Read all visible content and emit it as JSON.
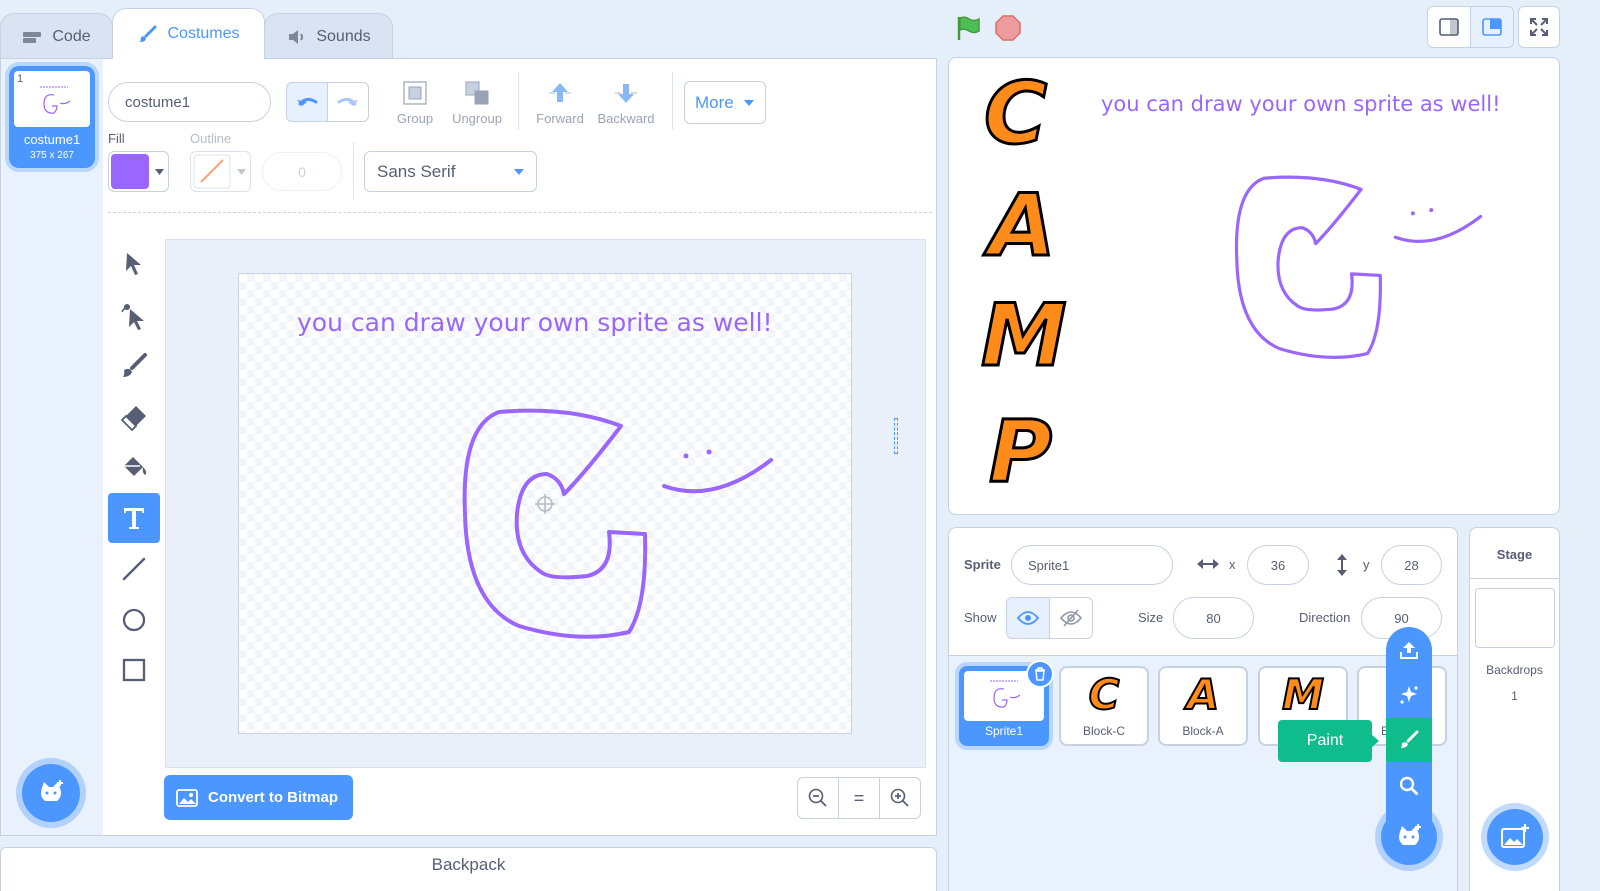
{
  "tabs": [
    {
      "label": "Code",
      "icon": "code-icon"
    },
    {
      "label": "Costumes",
      "icon": "brush-icon"
    },
    {
      "label": "Sounds",
      "icon": "speaker-icon"
    }
  ],
  "costume_list": {
    "items": [
      {
        "index": "1",
        "name": "costume1",
        "size": "375 x 267"
      }
    ]
  },
  "paint_editor": {
    "costume_name": "costume1",
    "group_label": "Group",
    "ungroup_label": "Ungroup",
    "forward_label": "Forward",
    "backward_label": "Backward",
    "more_label": "More",
    "fill_label": "Fill",
    "outline_label": "Outline",
    "outline_width": "0",
    "font": "Sans Serif",
    "fill_color": "#9966ff",
    "canvas_text": "you can draw your own sprite as well!",
    "convert_label": "Convert to Bitmap",
    "zoom_reset": "="
  },
  "backpack_label": "Backpack",
  "stage_preview": {
    "letters": [
      "C",
      "A",
      "M",
      "P"
    ],
    "text": "you can draw your own sprite as well!"
  },
  "sprite_info": {
    "sprite_label": "Sprite",
    "name": "Sprite1",
    "x_label": "x",
    "x": "36",
    "y_label": "y",
    "y": "28",
    "show_label": "Show",
    "size_label": "Size",
    "size": "80",
    "direction_label": "Direction",
    "direction": "90"
  },
  "sprites": [
    {
      "name": "Sprite1",
      "letter": ""
    },
    {
      "name": "Block-C",
      "letter": "C"
    },
    {
      "name": "Block-A",
      "letter": "A"
    },
    {
      "name": "",
      "letter": "M"
    },
    {
      "name": "B",
      "letter": ""
    }
  ],
  "sprite_menu_tooltip": "Paint",
  "stage_panel": {
    "title": "Stage",
    "backdrops_label": "Backdrops",
    "backdrops_count": "1"
  },
  "colors": {
    "accent": "#4c97ff",
    "purple": "#9966ff",
    "paint_green": "#0fbd8c",
    "camp_orange": "#ff8c1a"
  }
}
